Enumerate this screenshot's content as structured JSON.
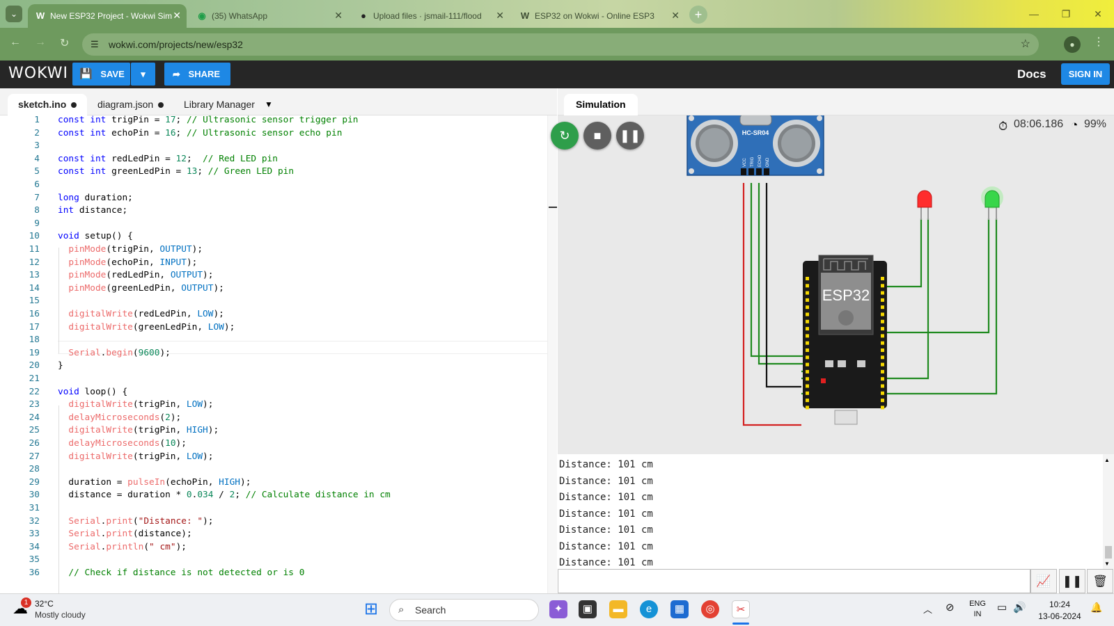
{
  "browser": {
    "tabs": [
      {
        "label": "New ESP32 Project - Wokwi Sim",
        "favicon": "W",
        "active": true
      },
      {
        "label": "(35) WhatsApp",
        "favicon": "whatsapp-icon",
        "active": false
      },
      {
        "label": "Upload files · jsmail-111/flood",
        "favicon": "github-icon",
        "active": false
      },
      {
        "label": "ESP32 on Wokwi - Online ESP3",
        "favicon": "W",
        "active": false
      }
    ],
    "url": "wokwi.com/projects/new/esp32"
  },
  "header": {
    "logo": "WOKWI",
    "save_label": "SAVE",
    "share_label": "SHARE",
    "docs_label": "Docs",
    "signin_label": "SIGN IN"
  },
  "editor": {
    "tabs": [
      {
        "label": "sketch.ino",
        "modified": true
      },
      {
        "label": "diagram.json",
        "modified": true
      },
      {
        "label": "Library Manager",
        "modified": false
      }
    ],
    "lines": [
      "const int trigPin = 17; // Ultrasonic sensor trigger pin",
      "const int echoPin = 16; // Ultrasonic sensor echo pin",
      "",
      "const int redLedPin = 12;  // Red LED pin",
      "const int greenLedPin = 13; // Green LED pin",
      "",
      "long duration;",
      "int distance;",
      "",
      "void setup() {",
      "  pinMode(trigPin, OUTPUT);",
      "  pinMode(echoPin, INPUT);",
      "  pinMode(redLedPin, OUTPUT);",
      "  pinMode(greenLedPin, OUTPUT);",
      "",
      "  digitalWrite(redLedPin, LOW);",
      "  digitalWrite(greenLedPin, LOW);",
      "",
      "  Serial.begin(9600);",
      "}",
      "",
      "void loop() {",
      "  digitalWrite(trigPin, LOW);",
      "  delayMicroseconds(2);",
      "  digitalWrite(trigPin, HIGH);",
      "  delayMicroseconds(10);",
      "  digitalWrite(trigPin, LOW);",
      "",
      "  duration = pulseIn(echoPin, HIGH);",
      "  distance = duration * 0.034 / 2; // Calculate distance in cm",
      "",
      "  Serial.print(\"Distance: \");",
      "  Serial.print(distance);",
      "  Serial.println(\" cm\");",
      "",
      "  // Check if distance is not detected or is 0"
    ]
  },
  "simulation": {
    "tab_label": "Simulation",
    "timer": "08:06.186",
    "performance": "99%",
    "sensor_label": "HC-SR04",
    "sensor_pins": [
      "VCC",
      "TRIG",
      "ECHO",
      "GND"
    ],
    "board_label": "ESP32",
    "serial_lines": [
      "Distance: 101 cm",
      "Distance: 101 cm",
      "Distance: 101 cm",
      "Distance: 101 cm",
      "Distance: 101 cm",
      "Distance: 101 cm",
      "Distance: 101 cm"
    ],
    "colors": {
      "wire_green": "#1f8a1f",
      "wire_red": "#d32020",
      "wire_black": "#111111",
      "led_red": "#ff2d2d",
      "led_green": "#38d64a",
      "sensor_blue": "#2f6fb8"
    }
  },
  "taskbar": {
    "weather_temp": "32°C",
    "weather_desc": "Mostly cloudy",
    "weather_badge": "1",
    "search_placeholder": "Search",
    "lang_top": "ENG",
    "lang_bottom": "IN",
    "time": "10:24",
    "date": "13-06-2024"
  }
}
